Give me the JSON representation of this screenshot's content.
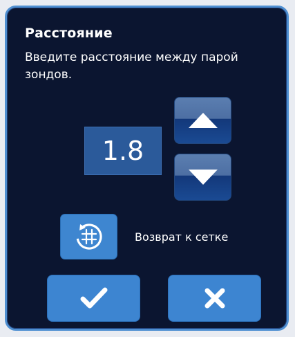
{
  "dialog": {
    "title": "Расстояние",
    "message": "Введите расстояние между парой зондов.",
    "value": "1.8",
    "grid_return_label": "Возврат к сетке"
  },
  "icons": {
    "increment": "triangle-up-icon",
    "decrement": "triangle-down-icon",
    "grid_return": "grid-reset-icon",
    "confirm": "checkmark-icon",
    "cancel": "close-x-icon"
  },
  "colors": {
    "background": "#0b1530",
    "border": "#4f8fd1",
    "button": "#3d85d1",
    "value_box": "#2b5a9a"
  }
}
